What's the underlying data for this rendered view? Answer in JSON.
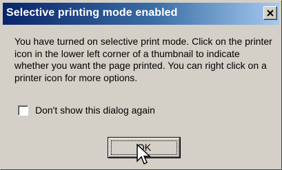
{
  "dialog": {
    "title": "Selective printing mode enabled",
    "close_icon": "close-icon",
    "message": "You have turned on selective print mode. Click on the printer icon in the lower left corner of a thumbnail to indicate whether you want the page printed.  You can right click on a printer icon for more options.",
    "checkbox": {
      "label": "Don't show this dialog again",
      "checked": false
    },
    "ok_label": "OK",
    "cursor_icon": "mouse-pointer-icon"
  },
  "colors": {
    "titlebar_start": "#0a246a",
    "titlebar_end": "#a6caf0",
    "face": "#d4d0c8"
  }
}
